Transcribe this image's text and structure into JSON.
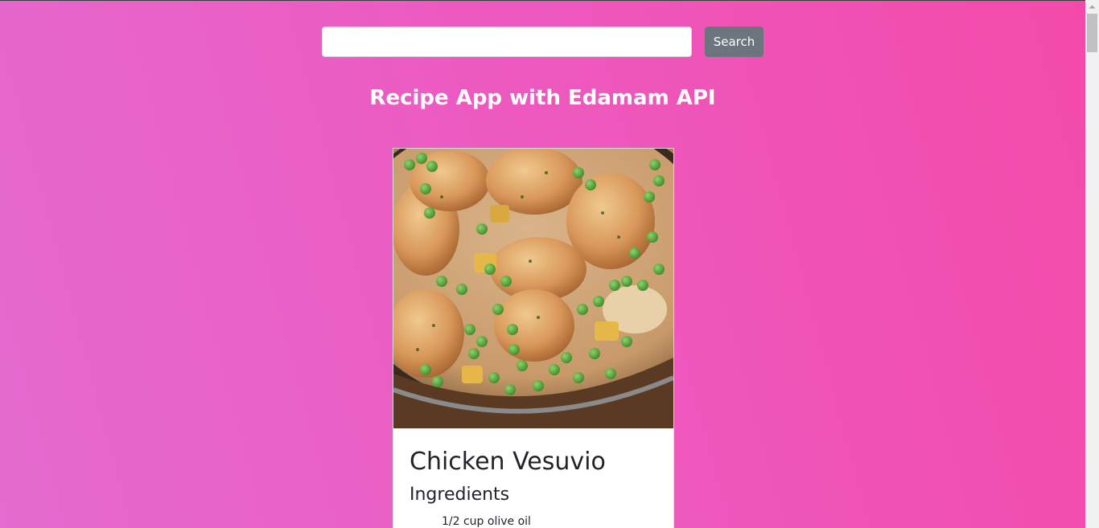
{
  "search": {
    "input_value": "",
    "button_label": "Search"
  },
  "page": {
    "title": "Recipe App with Edamam API"
  },
  "recipes": [
    {
      "title": "Chicken Vesuvio",
      "ingredients_heading": "Ingredients",
      "ingredients": [
        "1/2 cup olive oil"
      ]
    }
  ],
  "colors": {
    "background_start": "#e46bcf",
    "background_end": "#f34aa9",
    "button_bg": "#6c757d",
    "card_bg": "#ffffff"
  }
}
